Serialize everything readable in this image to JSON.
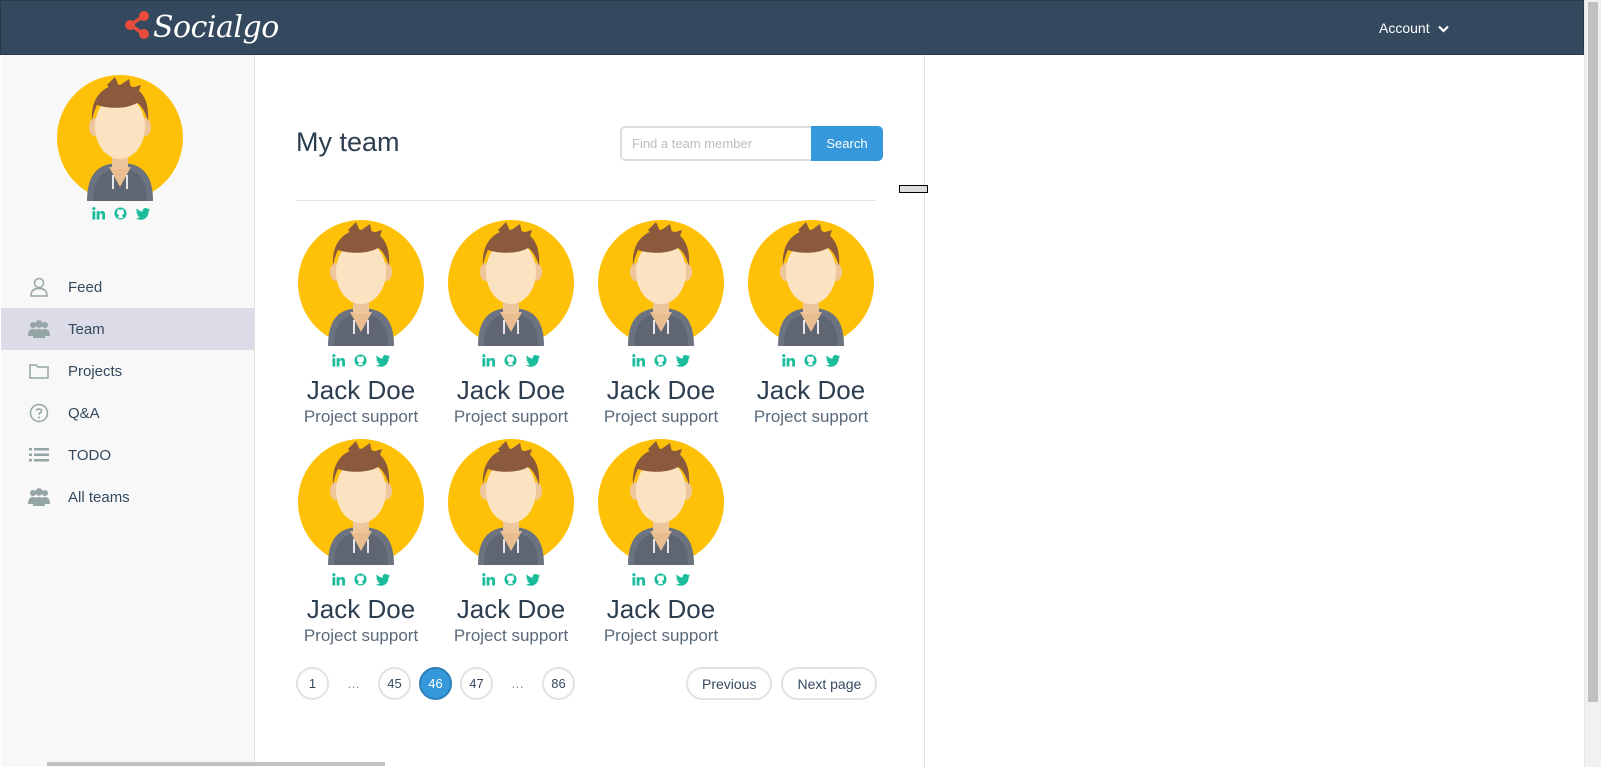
{
  "brand": {
    "name": "Socialgo",
    "accent": "#e74c3c"
  },
  "header": {
    "account_label": "Account"
  },
  "sidebar": {
    "items": [
      {
        "label": "Feed",
        "icon": "user-icon",
        "active": false
      },
      {
        "label": "Team",
        "icon": "users-icon",
        "active": true
      },
      {
        "label": "Projects",
        "icon": "folder-icon",
        "active": false
      },
      {
        "label": "Q&A",
        "icon": "question-icon",
        "active": false
      },
      {
        "label": "TODO",
        "icon": "list-icon",
        "active": false
      },
      {
        "label": "All teams",
        "icon": "users-icon",
        "active": false
      }
    ]
  },
  "main": {
    "title": "My team",
    "search": {
      "placeholder": "Find a team member",
      "button_label": "Search"
    },
    "members": [
      {
        "name": "Jack Doe",
        "role": "Project support"
      },
      {
        "name": "Jack Doe",
        "role": "Project support"
      },
      {
        "name": "Jack Doe",
        "role": "Project support"
      },
      {
        "name": "Jack Doe",
        "role": "Project support"
      },
      {
        "name": "Jack Doe",
        "role": "Project support"
      },
      {
        "name": "Jack Doe",
        "role": "Project support"
      },
      {
        "name": "Jack Doe",
        "role": "Project support"
      }
    ],
    "pagination": {
      "pages": [
        "1",
        "…",
        "45",
        "46",
        "47",
        "…",
        "86"
      ],
      "current": "46",
      "previous_label": "Previous",
      "next_label": "Next page"
    }
  },
  "colors": {
    "topbar": "#34495e",
    "primary": "#3498db",
    "social": "#1abc9c",
    "avatar_bg": "#fec107"
  }
}
